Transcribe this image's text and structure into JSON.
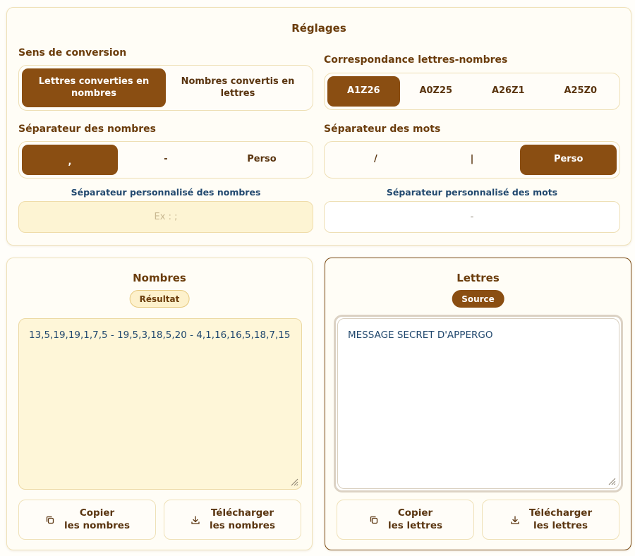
{
  "settings": {
    "title": "Réglages",
    "direction": {
      "label": "Sens de conversion",
      "options": [
        "Lettres converties en nombres",
        "Nombres convertis en lettres"
      ],
      "selected_index": 0
    },
    "mapping": {
      "label": "Correspondance lettres-nombres",
      "options": [
        "A1Z26",
        "A0Z25",
        "A26Z1",
        "A25Z0"
      ],
      "selected_index": 0
    },
    "number_separator": {
      "label": "Séparateur des nombres",
      "options": [
        ",",
        "-",
        "Perso"
      ],
      "selected_index": 0
    },
    "word_separator": {
      "label": "Séparateur des mots",
      "options": [
        "/",
        "|",
        "Perso"
      ],
      "selected_index": 2
    },
    "custom_number_separator": {
      "label": "Séparateur personnalisé des nombres",
      "placeholder": "Ex : ;"
    },
    "custom_word_separator": {
      "label": "Séparateur personnalisé des mots",
      "value": "-"
    }
  },
  "numbers_panel": {
    "title": "Nombres",
    "badge": "Résultat",
    "content": "13,5,19,19,1,7,5 - 19,5,3,18,5,20 - 4,1,16,16,5,18,7,15",
    "copy_button": {
      "line1": "Copier",
      "line2": "les nombres",
      "icon": "copy-icon"
    },
    "download_button": {
      "line1": "Télécharger",
      "line2": "les nombres",
      "icon": "download-icon"
    }
  },
  "letters_panel": {
    "title": "Lettres",
    "badge": "Source",
    "content": "MESSAGE SECRET D'APPERGO",
    "copy_button": {
      "line1": "Copier",
      "line2": "les lettres",
      "icon": "copy-icon"
    },
    "download_button": {
      "line1": "Télécharger",
      "line2": "les lettres",
      "icon": "download-icon"
    }
  },
  "colors": {
    "accent": "#8a4e12",
    "text_brown": "#6b3d0c",
    "text_blue": "#21486e",
    "result_bg": "#fef6d8"
  }
}
